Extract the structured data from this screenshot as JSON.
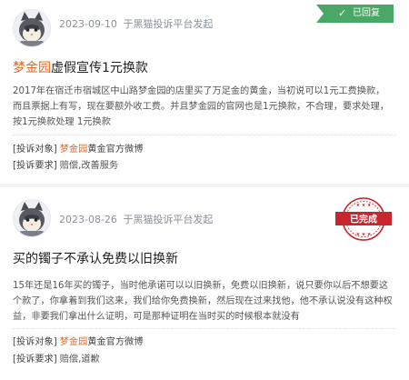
{
  "colors": {
    "brand": "#e8661e",
    "replied_green": "#4aa866",
    "done_red": "#c9252c"
  },
  "complaints": [
    {
      "avatar_icon": "cat-avatar-icon",
      "date": "2023-09-10",
      "source": "于黑猫投诉平台发起",
      "status": "已回复",
      "title_brand": "梦金园",
      "title_rest": "虚假宣传1元换款",
      "description": "2017年在宿迁市宿城区中山路梦金园的店里买了万足金的黄金，当初说可以1元工费换款，而且票据上有写，现在要额外收工费。并且梦金园的官网也是1元换款，不合理，要求处理，按1元换款处理 1元换款",
      "target_label": "[投诉对象]",
      "target_brand": "梦金园",
      "target_rest": "黄金官方微博",
      "demand_label": "[投诉要求]",
      "demand_value": "赔偿,改善服务"
    },
    {
      "avatar_icon": "cat-avatar-icon",
      "date": "2023-08-26",
      "source": "于黑猫投诉平台发起",
      "status": "已完成",
      "title_brand": "",
      "title_rest": "买的镯子不承认免费以旧换新",
      "description": "15年还是16年买的镯子，当时他承诺可以以旧换新，免费以旧换新，说只要你以后不想要这个款了，你拿着到我们这来，我们给你免费换新，然后现在过来找他，他不承认说没有这种权益，非要我们拿出什么证明，可是那种证明在当时买的时候根本就没有",
      "target_label": "[投诉对象]",
      "target_brand": "梦金园",
      "target_rest": "黄金官方微博",
      "demand_label": "[投诉要求]",
      "demand_value": "赔偿,道歉"
    }
  ]
}
